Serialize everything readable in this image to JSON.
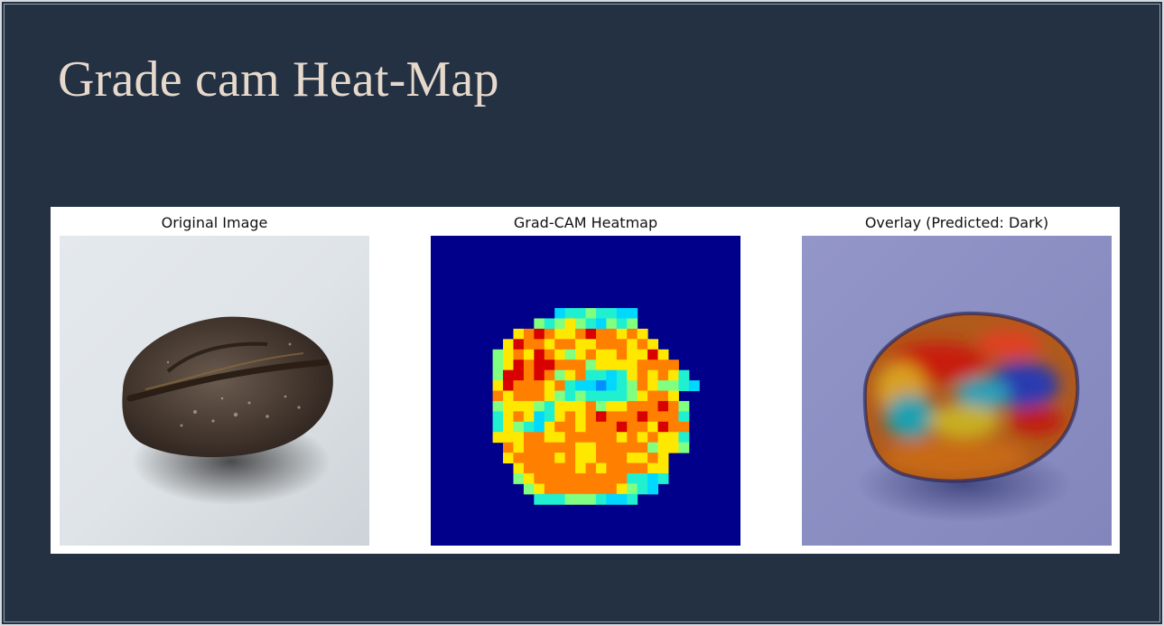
{
  "slide": {
    "title": "Grade cam Heat-Map"
  },
  "figure": {
    "panels": [
      {
        "title": "Original Image"
      },
      {
        "title": "Grad-CAM Heatmap"
      },
      {
        "title": "Overlay (Predicted: Dark)"
      }
    ]
  },
  "colors": {
    "slide_background": "#243143",
    "title_text": "#e6d9cc",
    "heatmap_background": "#00008b"
  },
  "heatmap": {
    "colormap": "jet",
    "grid": [
      "..............................",
      "..............................",
      "..............................",
      "..............................",
      "..............................",
      "..............................",
      "..............................",
      "............45565544..........",
      "..........6567654656..........",
      "........7898778988787.........",
      ".......798878877888787........",
      "......67879876787787797.......",
      "......679899888677778888......",
      "......6998986785545787875.....",
      "......79888785443456876654.....",
      "......878887656555567887......",
      "......6777657778677888986.....",
      "......5787457878988898885.....",
      "......5765478878889887988.....",
      "......7778877888887878775.....",
      ".......878888877888886776.....",
      ".......7888878778887787.......",
      "........788888787888877.......",
      "........678888888885545.......",
      ".........6788888887654........",
      "..........5556665445..........",
      "..............................",
      "..............................",
      "..............................",
      ".............................."
    ]
  }
}
